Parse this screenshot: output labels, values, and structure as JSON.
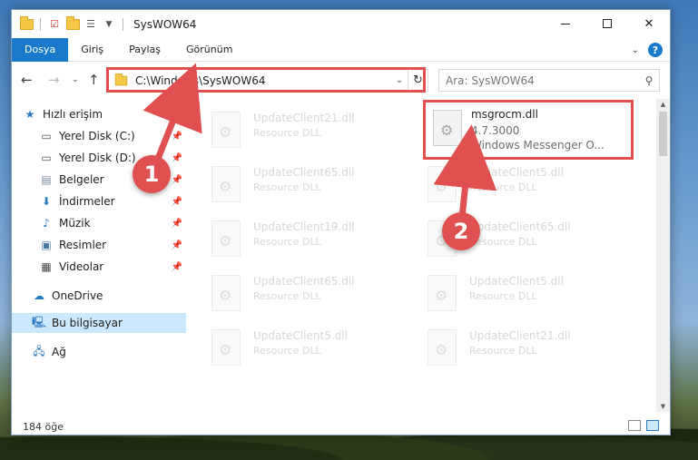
{
  "window": {
    "title": "SysWOW64",
    "controls": {
      "minimize": "minimize",
      "maximize": "maximize",
      "close": "✕"
    }
  },
  "ribbon": {
    "tabs": [
      {
        "label": "Dosya",
        "active": true
      },
      {
        "label": "Giriş"
      },
      {
        "label": "Paylaş"
      },
      {
        "label": "Görünüm"
      }
    ]
  },
  "navigation": {
    "address": "C:\\Windows\\SysWOW64",
    "search_placeholder": "Ara: SysWOW64"
  },
  "navpane": {
    "quick_access": "Hızlı erişim",
    "items": [
      {
        "label": "Yerel Disk (C:)",
        "icon": "drive-icon",
        "pinned": true
      },
      {
        "label": "Yerel Disk (D:)",
        "icon": "drive-icon",
        "pinned": true
      },
      {
        "label": "Belgeler",
        "icon": "documents-icon",
        "pinned": true
      },
      {
        "label": "İndirmeler",
        "icon": "downloads-icon",
        "pinned": true
      },
      {
        "label": "Müzik",
        "icon": "music-icon",
        "pinned": true
      },
      {
        "label": "Resimler",
        "icon": "pictures-icon",
        "pinned": true
      },
      {
        "label": "Videolar",
        "icon": "videos-icon",
        "pinned": true
      }
    ],
    "onedrive": "OneDrive",
    "this_pc": "Bu bilgisayar",
    "network": "Ağ"
  },
  "files": {
    "left": [
      {
        "name": "UpdateClient21.dll",
        "type": "Resource DLL"
      },
      {
        "name": "UpdateClient65.dll",
        "type": "Resource DLL"
      },
      {
        "name": "UpdateClient19.dll",
        "type": "Resource DLL"
      },
      {
        "name": "UpdateClient65.dll",
        "type": "Resource DLL"
      },
      {
        "name": "UpdateClient5.dll",
        "type": "Resource DLL"
      }
    ],
    "right_highlight": {
      "name": "msgrocm.dll",
      "version": "4.7.3000",
      "description": "Windows Messenger O..."
    },
    "right": [
      {
        "name": "UpdateClient5.dll",
        "type": "Resource DLL"
      },
      {
        "name": "UpdateClient65.dll",
        "type": "Resource DLL"
      },
      {
        "name": "UpdateClient5.dll",
        "type": "Resource DLL"
      },
      {
        "name": "UpdateClient21.dll",
        "type": "Resource DLL"
      }
    ]
  },
  "status": {
    "count": "184 öğe"
  },
  "markers": {
    "one": "1",
    "two": "2"
  },
  "colors": {
    "accent": "#1979ca",
    "highlight": "#e05050",
    "selected": "#cce8ff"
  }
}
